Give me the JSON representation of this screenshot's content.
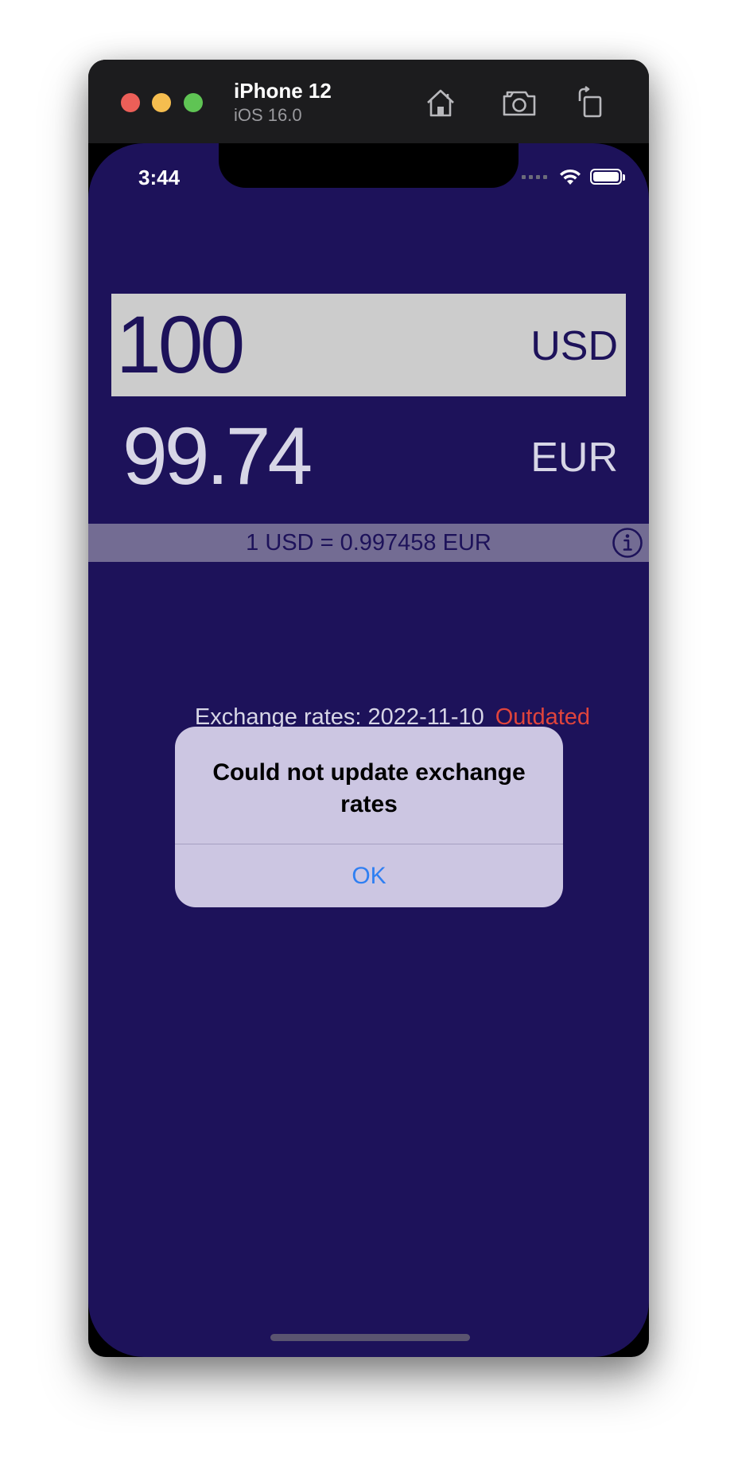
{
  "simulator": {
    "device_name": "iPhone 12",
    "os_version": "iOS 16.0",
    "toolbar_icons": [
      "home-icon",
      "screenshot-icon",
      "rotate-icon"
    ]
  },
  "status_bar": {
    "time": "3:44",
    "icons": [
      "cellular-signal-icon",
      "wifi-icon",
      "battery-icon"
    ]
  },
  "converter": {
    "from": {
      "amount": "100",
      "currency": "USD"
    },
    "to": {
      "amount": "99.74",
      "currency": "EUR"
    },
    "rate_text": "1 USD = 0.997458 EUR",
    "rates_date_text": "Exchange rates: 2022-11-10",
    "outdated_text": "Outdated"
  },
  "alert": {
    "title": "Could not update exchange rates",
    "ok_label": "OK"
  },
  "colors": {
    "background": "#1d125a",
    "from_row": "#cccccc",
    "rate_bar": "#736c93",
    "outdated": "#e0443c",
    "alert_bg": "#ccc6e2",
    "alert_button": "#2f7ff2"
  }
}
